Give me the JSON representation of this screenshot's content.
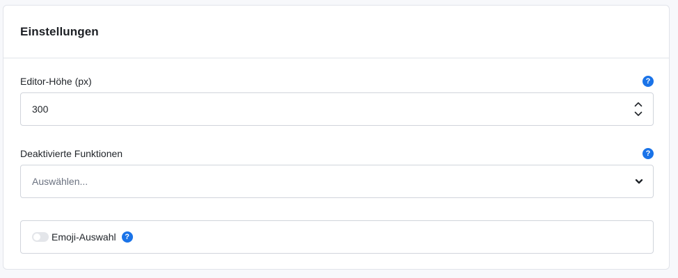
{
  "header": {
    "title": "Einstellungen"
  },
  "fields": {
    "editor_height": {
      "label": "Editor-Höhe (px)",
      "value": "300",
      "help_icon": "question-circle-icon"
    },
    "disabled_features": {
      "label": "Deaktivierte Funktionen",
      "placeholder": "Auswählen...",
      "help_icon": "question-circle-icon"
    },
    "emoji_picker": {
      "label": "Emoji-Auswahl",
      "enabled": false,
      "help_icon": "question-circle-icon"
    }
  },
  "help_icon_glyph": "?",
  "colors": {
    "accent": "#1a73e8",
    "border": "#d0d4db",
    "background": "#f7f8fb"
  }
}
